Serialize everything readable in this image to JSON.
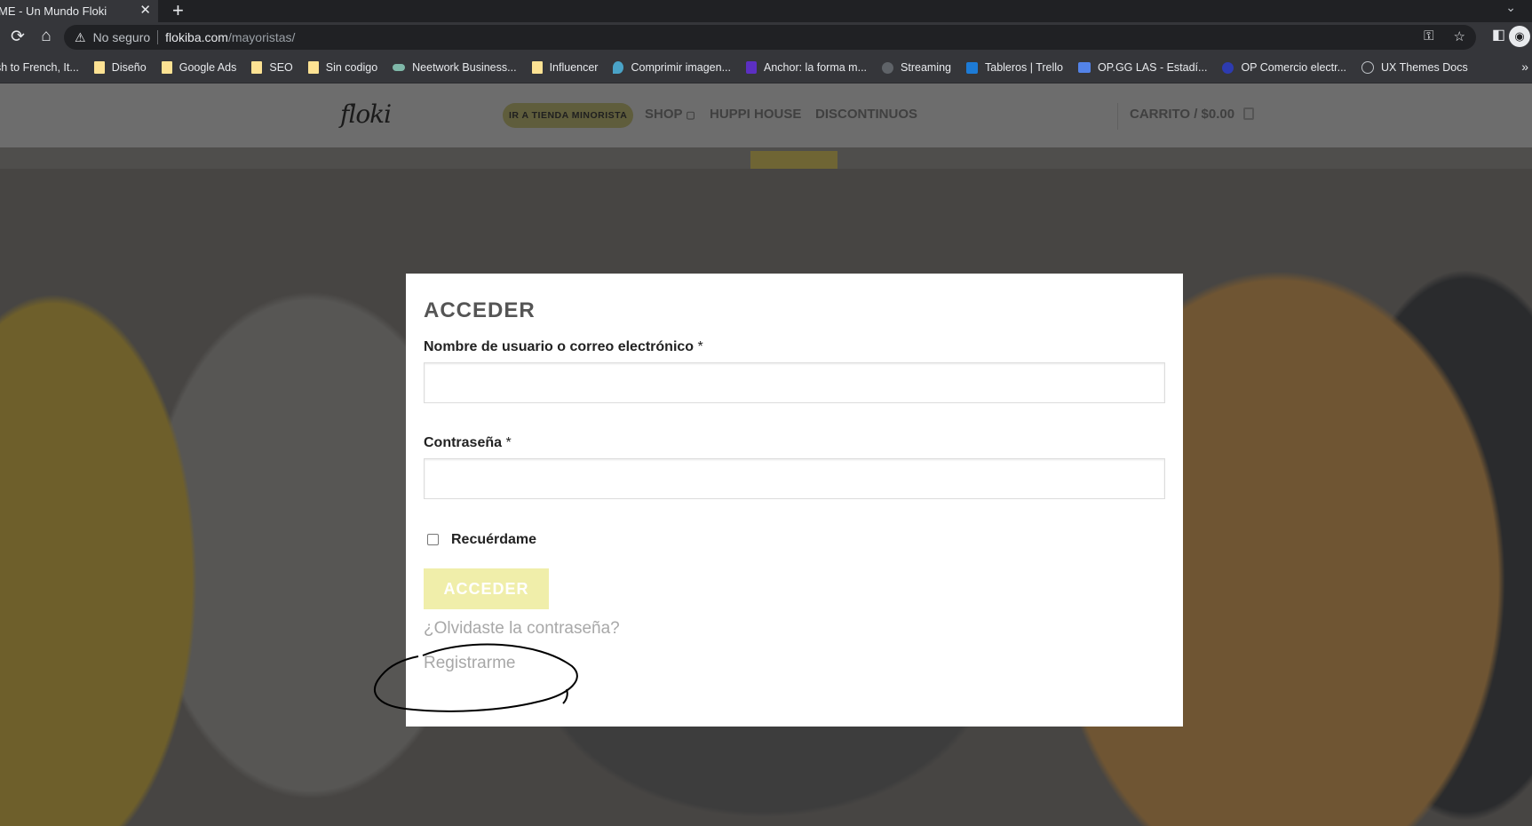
{
  "browser": {
    "tab_title": "ME - Un Mundo Floki",
    "tab_close": "✕",
    "new_tab": "+",
    "tab_menu": "⌄",
    "insecure_label": "No seguro",
    "url_domain": "flokiba.com",
    "url_path": "/mayoristas/",
    "bookmarks": [
      {
        "label": "sh to French, It...",
        "icon": "none"
      },
      {
        "label": "Diseño",
        "icon": "folder-icon"
      },
      {
        "label": "Google Ads",
        "icon": "folder-icon"
      },
      {
        "label": "SEO",
        "icon": "folder-icon"
      },
      {
        "label": "Sin codigo",
        "icon": "folder-icon"
      },
      {
        "label": "Neetwork Business...",
        "icon": "neetwork-icon"
      },
      {
        "label": "Influencer",
        "icon": "folder-icon"
      },
      {
        "label": "Comprimir imagen...",
        "icon": "compress-icon"
      },
      {
        "label": "Anchor: la forma m...",
        "icon": "anchor-icon"
      },
      {
        "label": "Streaming",
        "icon": "globe-icon"
      },
      {
        "label": "Tableros | Trello",
        "icon": "trello-icon"
      },
      {
        "label": "OP.GG LAS - Estadí...",
        "icon": "opgg-icon"
      },
      {
        "label": "OP Comercio electr...",
        "icon": "op-icon"
      },
      {
        "label": "UX Themes Docs",
        "icon": "ux-icon"
      }
    ],
    "bookmarks_more": "»"
  },
  "site": {
    "logo": "floki",
    "retail_button": "IR A TIENDA MINORISTA",
    "nav": [
      "SHOP ",
      "HUPPI HOUSE",
      "DISCONTINUOS"
    ],
    "cart": "CARRITO / $0.00"
  },
  "login": {
    "title": "ACCEDER",
    "username_label": "Nombre de usuario o correo electrónico",
    "password_label": "Contraseña",
    "required_mark": "*",
    "remember_label": "Recuérdame",
    "submit_label": "ACCEDER",
    "forgot_link": "¿Olvidaste la contraseña?",
    "register_link": "Registrarme"
  },
  "colors": {
    "accent": "#f0eeaa",
    "annotation": "#000000"
  }
}
